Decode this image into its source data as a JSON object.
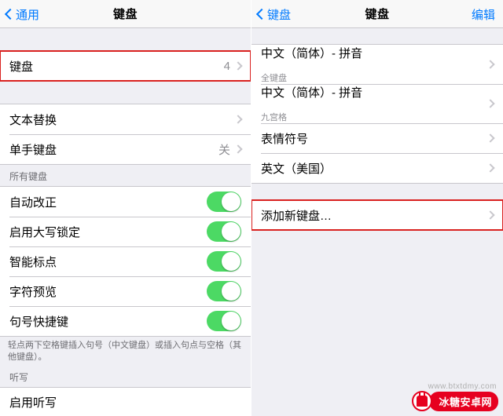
{
  "left": {
    "nav": {
      "back": "通用",
      "title": "键盘"
    },
    "keyboards_row": {
      "label": "键盘",
      "value": "4"
    },
    "group2": [
      {
        "label": "文本替换"
      },
      {
        "label": "单手键盘",
        "value": "关"
      }
    ],
    "all_keyboards_header": "所有键盘",
    "toggles": [
      {
        "label": "自动改正",
        "on": true
      },
      {
        "label": "启用大写锁定",
        "on": true
      },
      {
        "label": "智能标点",
        "on": true
      },
      {
        "label": "字符预览",
        "on": true
      },
      {
        "label": "句号快捷键",
        "on": true
      }
    ],
    "footer": "轻点两下空格键插入句号（中文键盘）或插入句点与空格（其他键盘）。",
    "dictation_header": "听写",
    "dictation_row": {
      "label": "启用听写"
    }
  },
  "right": {
    "nav": {
      "back": "键盘",
      "title": "键盘",
      "edit": "编辑"
    },
    "keyboards": [
      {
        "label": "中文（简体）- 拼音",
        "sub": "全键盘"
      },
      {
        "label": "中文（简体）- 拼音",
        "sub": "九宫格"
      },
      {
        "label": "表情符号"
      },
      {
        "label": "英文（美国）"
      }
    ],
    "add_row": {
      "label": "添加新键盘…"
    }
  },
  "watermark": {
    "text": "冰糖安卓网",
    "url": "www.btxtdmy.com"
  }
}
